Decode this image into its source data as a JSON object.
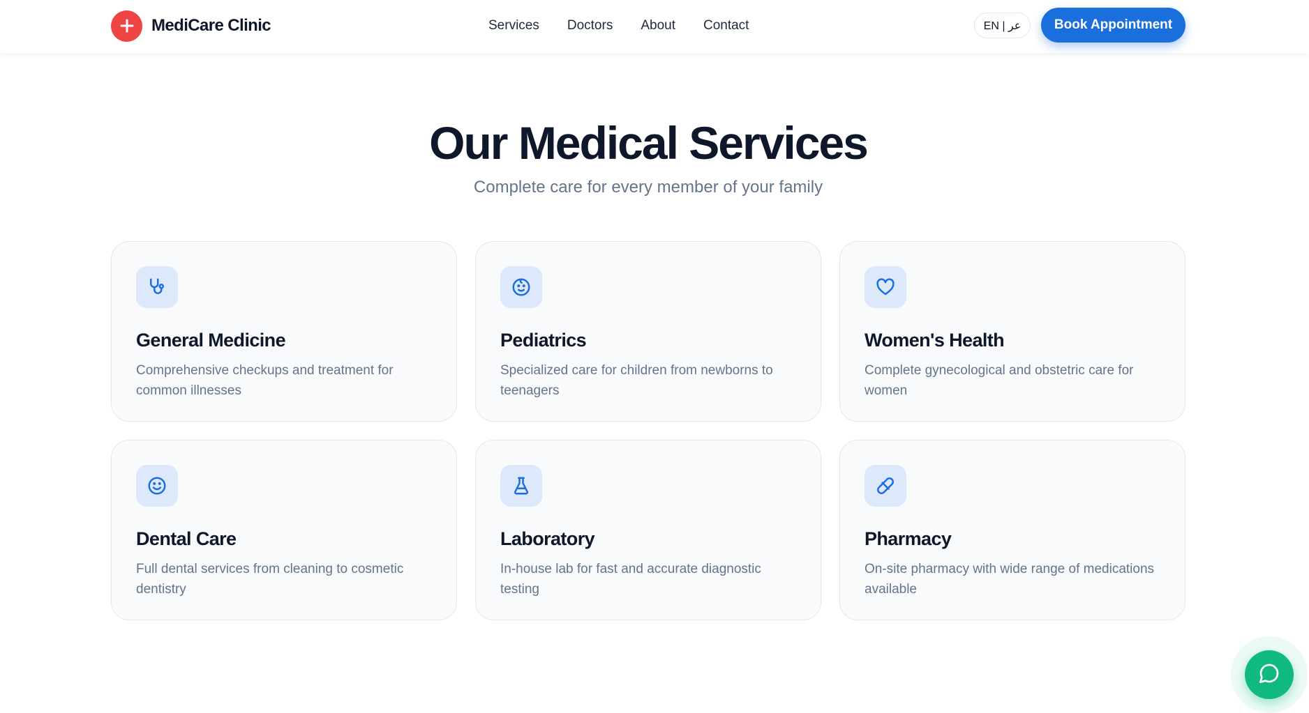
{
  "header": {
    "brand_name": "MediCare Clinic",
    "logo_icon": "plus-icon",
    "nav": [
      {
        "label": "Services"
      },
      {
        "label": "Doctors"
      },
      {
        "label": "About"
      },
      {
        "label": "Contact"
      }
    ],
    "lang_toggle": "EN | عر",
    "book_button": "Book Appointment"
  },
  "services": {
    "title": "Our Medical Services",
    "subtitle": "Complete care for every member of your family",
    "items": [
      {
        "icon": "stethoscope-icon",
        "title": "General Medicine",
        "description": "Comprehensive checkups and treatment for common illnesses"
      },
      {
        "icon": "baby-icon",
        "title": "Pediatrics",
        "description": "Specialized care for children from newborns to teenagers"
      },
      {
        "icon": "heart-icon",
        "title": "Women's Health",
        "description": "Complete gynecological and obstetric care for women"
      },
      {
        "icon": "smile-icon",
        "title": "Dental Care",
        "description": "Full dental services from cleaning to cosmetic dentistry"
      },
      {
        "icon": "flask-icon",
        "title": "Laboratory",
        "description": "In-house lab for fast and accurate diagnostic testing"
      },
      {
        "icon": "pill-icon",
        "title": "Pharmacy",
        "description": "On-site pharmacy with wide range of medications available"
      }
    ]
  },
  "chat_widget": {
    "icon": "chat-bubble-icon"
  },
  "colors": {
    "brand_red": "#ef4444",
    "primary_blue": "#1a6fdc",
    "icon_tile": "#dde9fb",
    "chat_green": "#10b981",
    "heading": "#0f172a",
    "muted_text": "#64748b"
  }
}
